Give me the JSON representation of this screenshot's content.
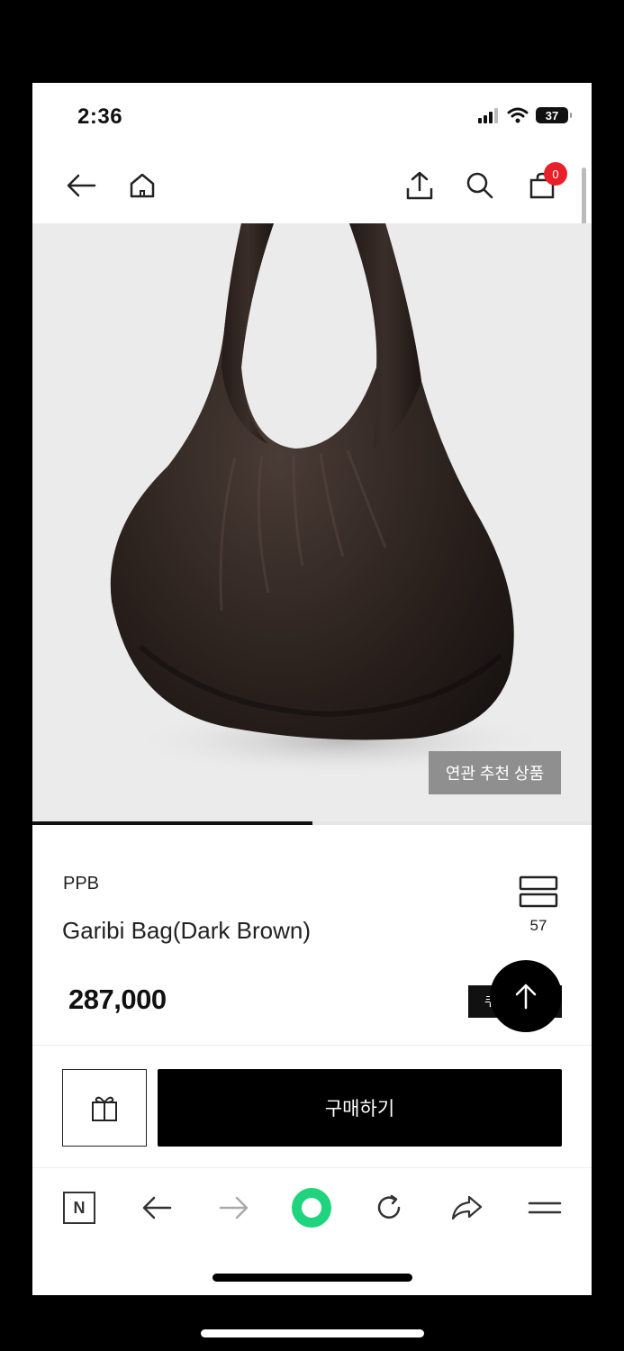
{
  "status_bar": {
    "time": "2:36",
    "battery": "37"
  },
  "nav": {
    "cart_count": "0"
  },
  "product": {
    "related_button": "연관 추천 상품",
    "image_progress": 0.5,
    "brand": "PPB",
    "name": "Garibi Bag(Dark Brown)",
    "list_count": "57",
    "price": "287,000",
    "coupon_chip": "쿠",
    "buy_button": "구매하기"
  },
  "colors": {
    "badge": "#e8202a",
    "accent_green": "#1fd47d",
    "image_bg": "#ebebeb"
  },
  "browser_toolbar": {
    "items": [
      "naver-n-icon",
      "back-arrow-icon",
      "forward-arrow-icon",
      "green-home-ring-icon",
      "refresh-icon",
      "share-icon",
      "menu-icon"
    ],
    "n_label": "N"
  }
}
